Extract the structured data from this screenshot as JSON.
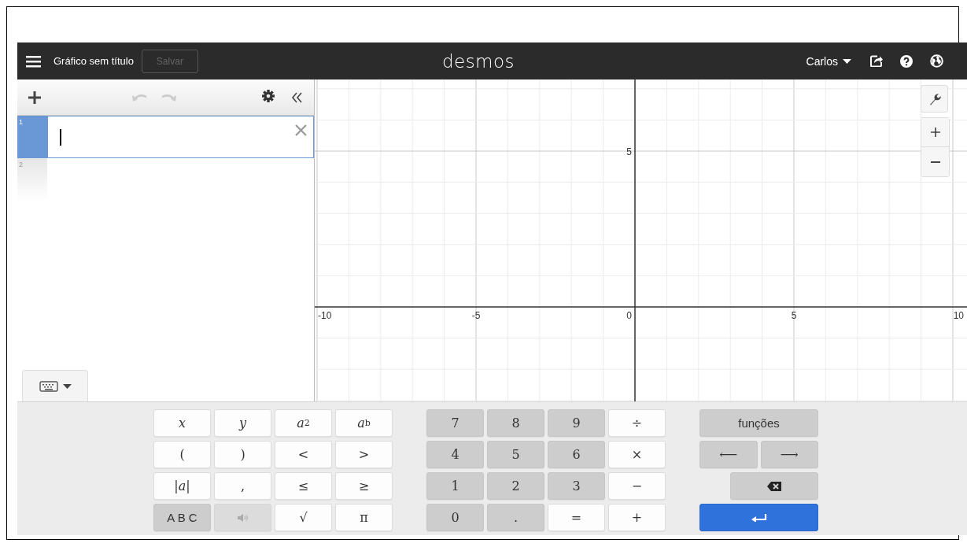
{
  "header": {
    "title": "Gráfico sem título",
    "save_button": {
      "label": "Salvar",
      "disabled": true
    },
    "logo": "desmos",
    "user": "Carlos"
  },
  "toolbar": {
    "undo": {
      "disabled": true
    },
    "redo": {
      "disabled": true
    }
  },
  "expressions": [
    {
      "number": "1",
      "selected": true
    },
    {
      "number": "2",
      "selected": false
    }
  ],
  "graph": {
    "x_labels": [
      "-10",
      "-5",
      "0",
      "5",
      "10"
    ],
    "y_labels": [
      "5"
    ]
  },
  "keypad_toggle": {
    "expanded": true
  },
  "keypad": {
    "left": [
      {
        "kind": "text",
        "label": "x"
      },
      {
        "kind": "text",
        "label": "y"
      },
      {
        "kind": "text",
        "label": "*a*$^{2}$"
      },
      {
        "kind": "text",
        "label": "*a*$^{b}$"
      },
      {
        "kind": "text",
        "label": "("
      },
      {
        "kind": "text",
        "label": ")"
      },
      {
        "kind": "text",
        "label": "<"
      },
      {
        "kind": "text",
        "label": ">"
      },
      {
        "kind": "text",
        "label": "|*a*|"
      },
      {
        "kind": "text",
        "label": ","
      },
      {
        "kind": "text",
        "label": "≤"
      },
      {
        "kind": "text",
        "label": "≥"
      },
      {
        "kind": "text",
        "label": "A B C"
      },
      {
        "kind": "icon"
      },
      {
        "kind": "text",
        "label": "√"
      },
      {
        "kind": "text",
        "label": "π"
      }
    ],
    "numbers": [
      {
        "kind": "text",
        "label": "7"
      },
      {
        "kind": "text",
        "label": "8"
      },
      {
        "kind": "text",
        "label": "9"
      },
      {
        "kind": "text",
        "label": "÷"
      },
      {
        "kind": "text",
        "label": "4"
      },
      {
        "kind": "text",
        "label": "5"
      },
      {
        "kind": "text",
        "label": "6"
      },
      {
        "kind": "text",
        "label": "×"
      },
      {
        "kind": "text",
        "label": "1"
      },
      {
        "kind": "text",
        "label": "2"
      },
      {
        "kind": "text",
        "label": "3"
      },
      {
        "kind": "text",
        "label": "−"
      },
      {
        "kind": "text",
        "label": "0"
      },
      {
        "kind": "text",
        "label": "."
      },
      {
        "kind": "text",
        "label": "="
      },
      {
        "kind": "text",
        "label": "+"
      }
    ],
    "right": [
      [
        {
          "kind": "text",
          "label": "funções"
        }
      ],
      [
        {
          "kind": "text",
          "label": "⟵"
        },
        {
          "kind": "text",
          "label": "⟶"
        }
      ],
      [
        {
          "kind": "icon"
        }
      ],
      [
        {
          "kind": "icon"
        }
      ]
    ]
  }
}
